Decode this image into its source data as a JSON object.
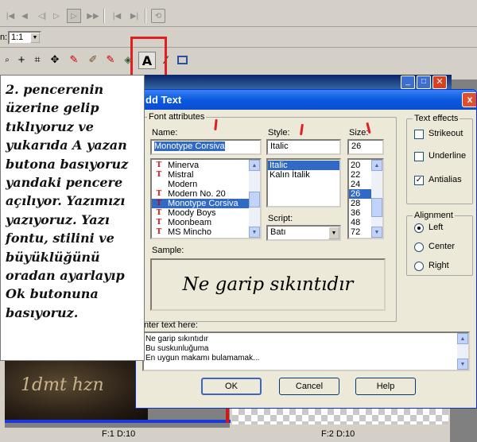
{
  "toolbar": {
    "zoom_label": "n:",
    "zoom_value": "1:1",
    "draw_tools": [
      "zoom-tool",
      "crosshair-tool",
      "crop-tool",
      "move-tool",
      "pen-tool",
      "brush-tool",
      "eraser-tool",
      "fill-tool",
      "text-tool",
      "line-tool",
      "rectangle-tool"
    ],
    "text_tool_glyph": "A"
  },
  "instructions": {
    "text": "2. pencerenin üzerine gelip tıklıyoruz ve yukarıda A yazan butona basıyoruz yandaki pencere açılıyor. Yazımızı yazıyoruz. Yazı fontu, stilini ve büyüklüğünü oradan ayarlayıp Ok butonuna basıyoruz."
  },
  "background": {
    "window_title_fragment": "s",
    "canvas_text": "1dmt hzn",
    "status_left": "F:1  D:10",
    "status_right": "F:2  D:10"
  },
  "dialog": {
    "title": "dd Text",
    "font_attributes_label": "Font attributes",
    "name_label": "Name:",
    "name_value": "Monotype Corsiva",
    "font_list": [
      {
        "name": "Minerva",
        "truetype": true,
        "selected": false
      },
      {
        "name": "Mistral",
        "truetype": true,
        "selected": false
      },
      {
        "name": "Modern",
        "truetype": false,
        "selected": false
      },
      {
        "name": "Modern No. 20",
        "truetype": true,
        "selected": false
      },
      {
        "name": "Monotype Corsiva",
        "truetype": true,
        "selected": true
      },
      {
        "name": "Moody Boys",
        "truetype": true,
        "selected": false
      },
      {
        "name": "Moonbeam",
        "truetype": true,
        "selected": false
      },
      {
        "name": "MS Mincho",
        "truetype": true,
        "selected": false
      }
    ],
    "style_label": "Style:",
    "style_value": "Italic",
    "style_list": [
      {
        "name": "Italic",
        "selected": true
      },
      {
        "name": "Kalın İtalik",
        "selected": false
      }
    ],
    "script_label": "Script:",
    "script_value": "Batı",
    "size_label": "Size:",
    "size_value": "26",
    "size_list": [
      {
        "name": "20",
        "selected": false
      },
      {
        "name": "22",
        "selected": false
      },
      {
        "name": "24",
        "selected": false
      },
      {
        "name": "26",
        "selected": true
      },
      {
        "name": "28",
        "selected": false
      },
      {
        "name": "36",
        "selected": false
      },
      {
        "name": "48",
        "selected": false
      },
      {
        "name": "72",
        "selected": false
      }
    ],
    "sample_label": "Sample:",
    "sample_text": "Ne garip sıkıntıdır",
    "enter_text_label": "nter text here:",
    "entered_text": [
      "Ne garip sıkıntıdır",
      "Bu suskunluğuma",
      "En uygun makamı bulamamak..."
    ],
    "text_effects_label": "Text effects",
    "effects": [
      {
        "label": "Strikeout",
        "checked": false
      },
      {
        "label": "Underline",
        "checked": false
      },
      {
        "label": "Antialias",
        "checked": true
      }
    ],
    "alignment_label": "Alignment",
    "alignments": [
      {
        "label": "Left",
        "selected": true
      },
      {
        "label": "Center",
        "selected": false
      },
      {
        "label": "Right",
        "selected": false
      }
    ],
    "ok_label": "OK",
    "cancel_label": "Cancel",
    "help_label": "Help",
    "close_glyph": "x"
  },
  "colors": {
    "xp_title_blue": "#0a246a",
    "highlight_blue": "#316ac5",
    "annotation_red": "#e02020"
  }
}
